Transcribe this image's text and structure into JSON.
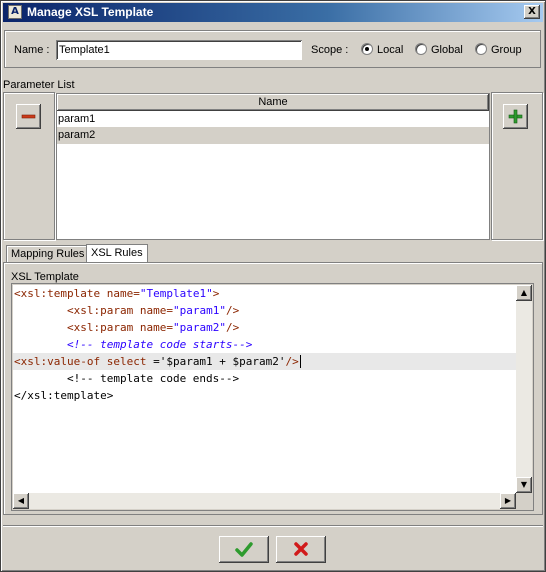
{
  "window": {
    "title": "Manage XSL Template",
    "close_glyph": "X",
    "icon_glyph": "A"
  },
  "form": {
    "name_label": "Name :",
    "name_value": "Template1",
    "scope_label": "Scope :",
    "scope_options": [
      "Local",
      "Global",
      "Group"
    ],
    "scope_selected": "Local"
  },
  "parameters": {
    "section_label": "Parameter List",
    "column_header": "Name",
    "rows": [
      "param1",
      "param2"
    ],
    "remove_icon": "minus-icon",
    "add_icon": "plus-icon"
  },
  "tabs": [
    {
      "label": "Mapping Rules",
      "active": false
    },
    {
      "label": "XSL Rules",
      "active": true
    }
  ],
  "editor": {
    "group_label": "XSL Template",
    "lines": [
      "<xsl:template name=\"Template1\">",
      "        <xsl:param name=\"param1\"/>",
      "        <xsl:param name=\"param2\"/>",
      "        <!-- template code starts-->",
      "<xsl:value-of select ='$param1 + $param2'/>",
      "        <!-- template code ends-->",
      "</xsl:template>"
    ]
  },
  "actions": {
    "ok_icon": "check-icon",
    "cancel_icon": "cross-icon",
    "ok_color": "#2e9b2e",
    "cancel_color": "#d11a1a",
    "add_color": "#2e9b2e",
    "remove_color": "#cc3a1a"
  }
}
